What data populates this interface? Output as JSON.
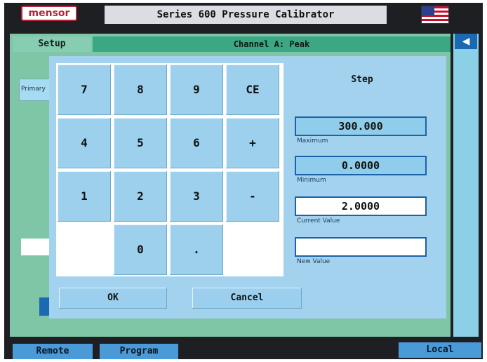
{
  "header": {
    "brand": "mensor",
    "title": "Series 600 Pressure Calibrator",
    "flag_icon": "us-flag-icon"
  },
  "tabs": {
    "setup": "Setup",
    "channel_title": "Channel A: Peak",
    "primary": "Primary"
  },
  "side": {
    "arrow_icon": "left-arrow-icon",
    "arrow_glyph": "◀"
  },
  "keypad": {
    "keys": [
      "7",
      "8",
      "9",
      "CE",
      "4",
      "5",
      "6",
      "+",
      "1",
      "2",
      "3",
      "-",
      "0",
      "."
    ]
  },
  "dialog": {
    "title": "Step",
    "maximum": {
      "value": "300.000",
      "label": "Maximum"
    },
    "minimum": {
      "value": "0.0000",
      "label": "Minimum"
    },
    "current": {
      "value": "2.0000",
      "label": "Current Value"
    },
    "new_value": {
      "value": "",
      "label": "New Value"
    },
    "ok": "OK",
    "cancel": "Cancel"
  },
  "bottom": {
    "remote": "Remote",
    "program": "Program",
    "local": "Local"
  },
  "colors": {
    "screen_green": "#7fc6a7",
    "dialog_blue": "#a3d2ee",
    "field_border": "#1c62a8",
    "brand_red": "#b3263a"
  }
}
